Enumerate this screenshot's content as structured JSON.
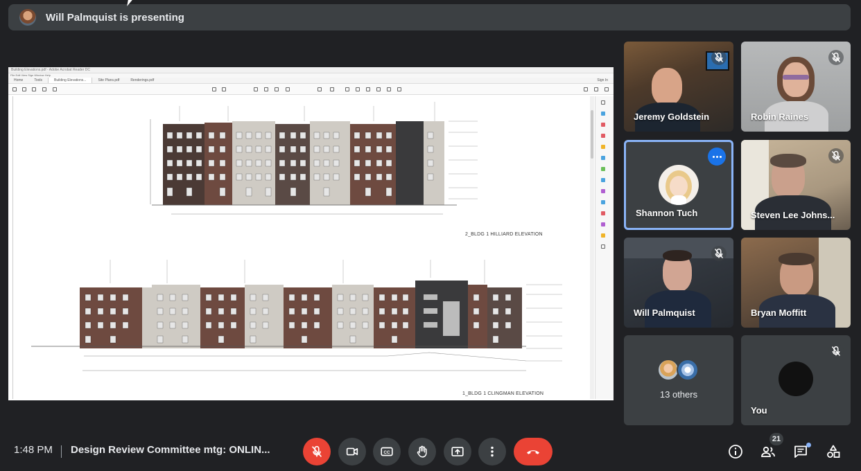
{
  "banner": {
    "presenting_text": "Will Palmquist is presenting"
  },
  "shared_screen": {
    "tabs": [
      "Home",
      "Tools",
      "Building Elevations...",
      "Site Plans.pdf",
      "Renderings.pdf"
    ],
    "sign_in": "Sign In",
    "elevation_top_label": "2_BLDG 1 HILLIARD ELEVATION",
    "elevation_bottom_label": "1_BLDG 1 CLINGMAN ELEVATION"
  },
  "participants": [
    {
      "name": "Jeremy Goldstein",
      "muted": true
    },
    {
      "name": "Robin Raines",
      "muted": true
    },
    {
      "name": "Shannon Tuch",
      "muted": false,
      "active_speaker": true
    },
    {
      "name": "Steven Lee Johns...",
      "muted": true
    },
    {
      "name": "Will Palmquist",
      "muted": true
    },
    {
      "name": "Bryan Moffitt",
      "muted": false
    },
    {
      "name": "13 others",
      "muted": false
    },
    {
      "name": "You",
      "muted": true
    }
  ],
  "bottom_bar": {
    "time": "1:48 PM",
    "meeting_title": "Design Review Committee mtg: ONLIN...",
    "participant_count": "21"
  },
  "colors": {
    "accent": "#8ab4f8",
    "danger": "#ea4335",
    "tile_bg": "#3c4043",
    "bg": "#202124"
  }
}
